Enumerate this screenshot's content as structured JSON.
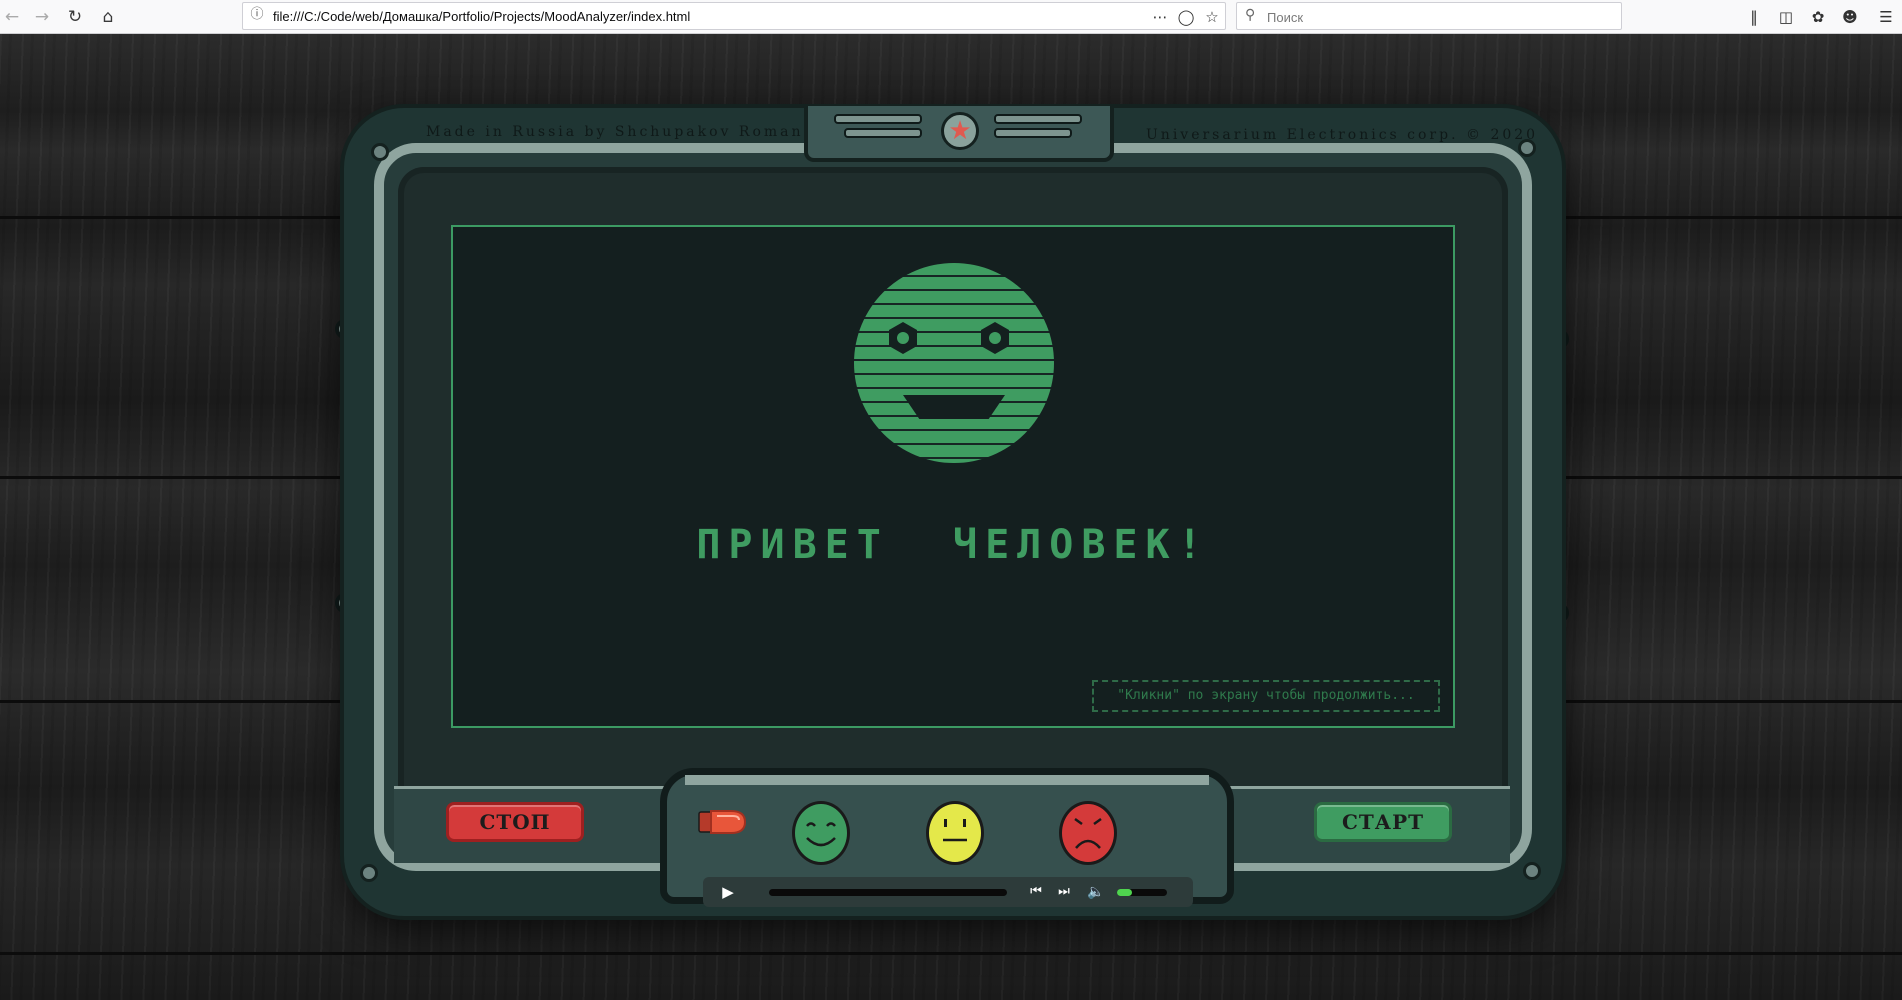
{
  "browser": {
    "url": "file:///C:/Code/web/Домашка/Portfolio/Projects/MoodAnalyzer/index.html",
    "search_placeholder": "Поиск",
    "icons": [
      "back-icon",
      "forward-icon",
      "reload-icon",
      "home-icon",
      "info-icon",
      "more-icon",
      "pocket-icon",
      "bookmark-star-icon",
      "search-icon",
      "library-icon",
      "sidebar-icon",
      "extension-icon",
      "account-icon",
      "menu-icon"
    ]
  },
  "device": {
    "header_left": "Made in Russia by Shchupakov Roman",
    "header_right": "Universarium Electronics corp. © 2020",
    "emblem_icon": "star-icon"
  },
  "screen": {
    "greeting": "ПРИВЕТ  ЧЕЛОВЕК!",
    "hint": "\"Кликни\" по экрану чтобы продолжить...",
    "face_color": "#3f9c61"
  },
  "controls": {
    "stop_label": "СТОП",
    "start_label": "СТАРТ",
    "moods": [
      {
        "name": "happy",
        "color": "#3f9c61"
      },
      {
        "name": "neutral",
        "color": "#e4e84a"
      },
      {
        "name": "sad",
        "color": "#d43a3a"
      }
    ],
    "indicator_color": "#e8563a"
  },
  "player": {
    "icons": [
      "play-icon",
      "prev-track-icon",
      "next-track-icon",
      "volume-icon"
    ],
    "volume_level": 0.3
  }
}
